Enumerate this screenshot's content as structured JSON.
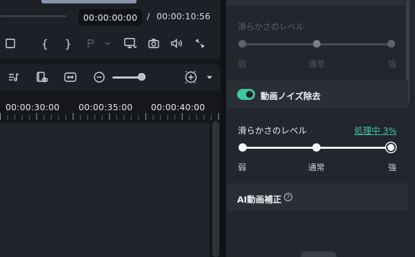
{
  "player": {
    "current_time": "00:00:00:00",
    "separator": "/",
    "total_time": "00:00:10:56",
    "controls": {
      "brace_open": "{",
      "brace_close": "}"
    }
  },
  "timeline": {
    "zoom_level": 0.9,
    "ruler_labels": [
      "00:00:30:00",
      "00:00:35:00",
      "00:00:40:00"
    ]
  },
  "panel": {
    "smoothness_dim": {
      "label": "滑らかさのレベル",
      "levels": [
        "弱",
        "通常",
        "強"
      ],
      "selected_index": 1
    },
    "noise_removal": {
      "title": "動画ノイズ除去",
      "enabled": true,
      "smoothness_label": "滑らかさのレベル",
      "status": "処理中 3%",
      "levels": [
        "弱",
        "通常",
        "強"
      ],
      "selected_index": 2
    },
    "ai_enhance": {
      "title": "AI動画補正",
      "help": "?"
    }
  },
  "colors": {
    "accent": "#3fc7a6",
    "background": "#15171b",
    "panel": "#23262c"
  },
  "icons": [
    "stop-icon",
    "mark-in-icon",
    "mark-out-icon",
    "marker-icon",
    "chevron-down-icon",
    "display-icon",
    "camera-icon",
    "volume-icon",
    "fullscreen-icon",
    "audio-list-icon",
    "clip-preview-icon",
    "fit-width-icon",
    "zoom-out-icon",
    "zoom-in-icon",
    "help-icon"
  ]
}
